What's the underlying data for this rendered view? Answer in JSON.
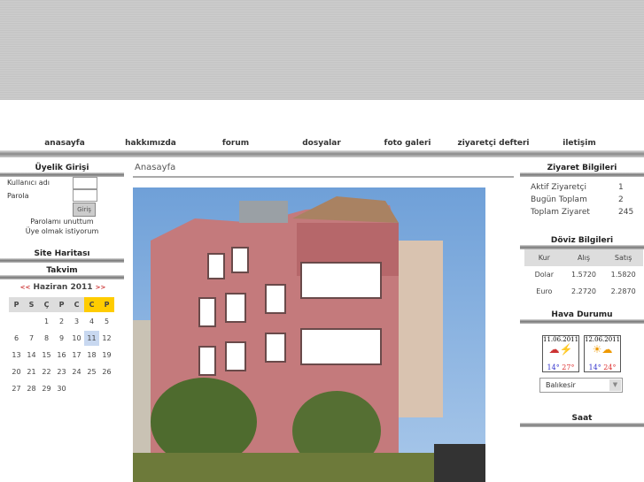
{
  "nav": [
    "anasayfa",
    "hakkımızda",
    "forum",
    "dosyalar",
    "foto galeri",
    "ziyaretçi defteri",
    "iletişim"
  ],
  "login": {
    "title": "Üyelik Girişi",
    "username_label": "Kullanıcı adı",
    "password_label": "Parola",
    "submit": "Giriş",
    "forgot": "Parolamı unuttum",
    "register": "Üye olmak istiyorum"
  },
  "sitemap": "Site Haritası",
  "calendar": {
    "title": "Takvim",
    "prev": "<<",
    "next": ">>",
    "month": "Haziran 2011",
    "days": [
      "P",
      "S",
      "Ç",
      "P",
      "C",
      "C",
      "P"
    ],
    "today": 11,
    "offset": 2,
    "count": 30
  },
  "main": {
    "title": "Anasayfa"
  },
  "visits": {
    "title": "Ziyaret Bilgileri",
    "rows": [
      {
        "label": "Aktif Ziyaretçi",
        "value": "1"
      },
      {
        "label": "Bugün Toplam",
        "value": "2"
      },
      {
        "label": "Toplam Ziyaret",
        "value": "245"
      }
    ]
  },
  "currency": {
    "title": "Döviz Bilgileri",
    "headers": [
      "Kur",
      "Alış",
      "Satış"
    ],
    "rows": [
      [
        "Dolar",
        "1.5720",
        "1.5820"
      ],
      [
        "Euro",
        "2.2720",
        "2.2870"
      ]
    ]
  },
  "weather": {
    "title": "Hava Durumu",
    "days": [
      {
        "date": "11.06.2011",
        "low": "14°",
        "high": "27°"
      },
      {
        "date": "12.06.2011",
        "low": "14°",
        "high": "24°"
      }
    ],
    "city": "Balıkesir"
  },
  "clock": {
    "title": "Saat"
  }
}
